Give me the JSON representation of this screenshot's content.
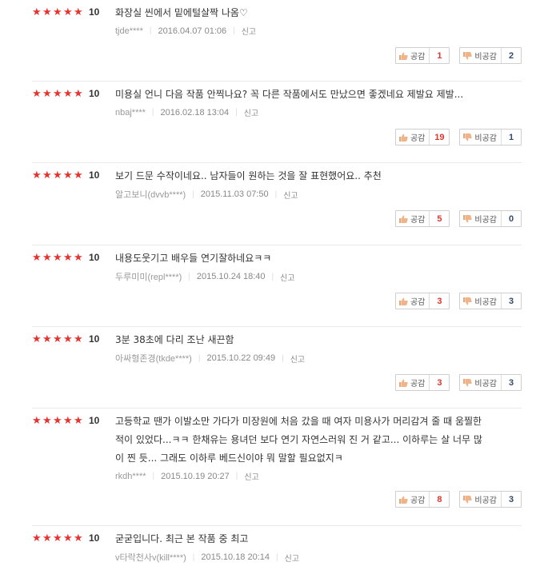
{
  "labels": {
    "like": "공감",
    "dislike": "비공감",
    "report": "신고"
  },
  "colors": {
    "star": "#e8322e",
    "like_count": "#e0342f",
    "dislike_count": "#334a6b"
  },
  "reviews": [
    {
      "stars": 5,
      "score": "10",
      "text": "화장실 씬에서 밑에털살짝 나옴♡",
      "user": "tjde****",
      "date": "2016.04.07 01:06",
      "likes": "1",
      "dislikes": "2"
    },
    {
      "stars": 5,
      "score": "10",
      "text": "미용실 언니 다음 작품 안찍나요? 꼭 다른 작품에서도 만났으면 좋겠네요 제발요 제발...",
      "user": "nbaj****",
      "date": "2016.02.18 13:04",
      "likes": "19",
      "dislikes": "1"
    },
    {
      "stars": 5,
      "score": "10",
      "text": "보기 드문 수작이네요.. 남자들이 원하는 것을 잘 표현했어요.. 추천",
      "user": "알고보니(dvvb****)",
      "date": "2015.11.03 07:50",
      "likes": "5",
      "dislikes": "0"
    },
    {
      "stars": 5,
      "score": "10",
      "text": "내용도웃기고 배우들 연기잘하네요ㅋㅋ",
      "user": "두루미미(repl****)",
      "date": "2015.10.24 18:40",
      "likes": "3",
      "dislikes": "3"
    },
    {
      "stars": 5,
      "score": "10",
      "text": "3분 38초에 다리 조난 새끈함",
      "user": "아싸형존경(tkde****)",
      "date": "2015.10.22 09:49",
      "likes": "3",
      "dislikes": "3"
    },
    {
      "stars": 5,
      "score": "10",
      "text": "고등학교 땐가 이발소만 가다가 미장원에 처음 갔을 때 여자 미용사가 머리감겨 줄 때 움찔한\n적이 있었다...ㅋㅋ 한채유는 용녀던 보다 연기 자연스러워 진 거 같고... 이하루는 살 너무 많\n이 찐 듯... 그래도 이하루 베드신이야 뭐 말할 필요없지ㅋ",
      "user": "rkdh****",
      "date": "2015.10.19 20:27",
      "likes": "8",
      "dislikes": "3"
    },
    {
      "stars": 5,
      "score": "10",
      "text": "굳굳입니다. 최근 본 작품 중 최고",
      "user": "v타락천사v(kill****)",
      "date": "2015.10.18 20:14",
      "likes": "",
      "dislikes": ""
    }
  ]
}
